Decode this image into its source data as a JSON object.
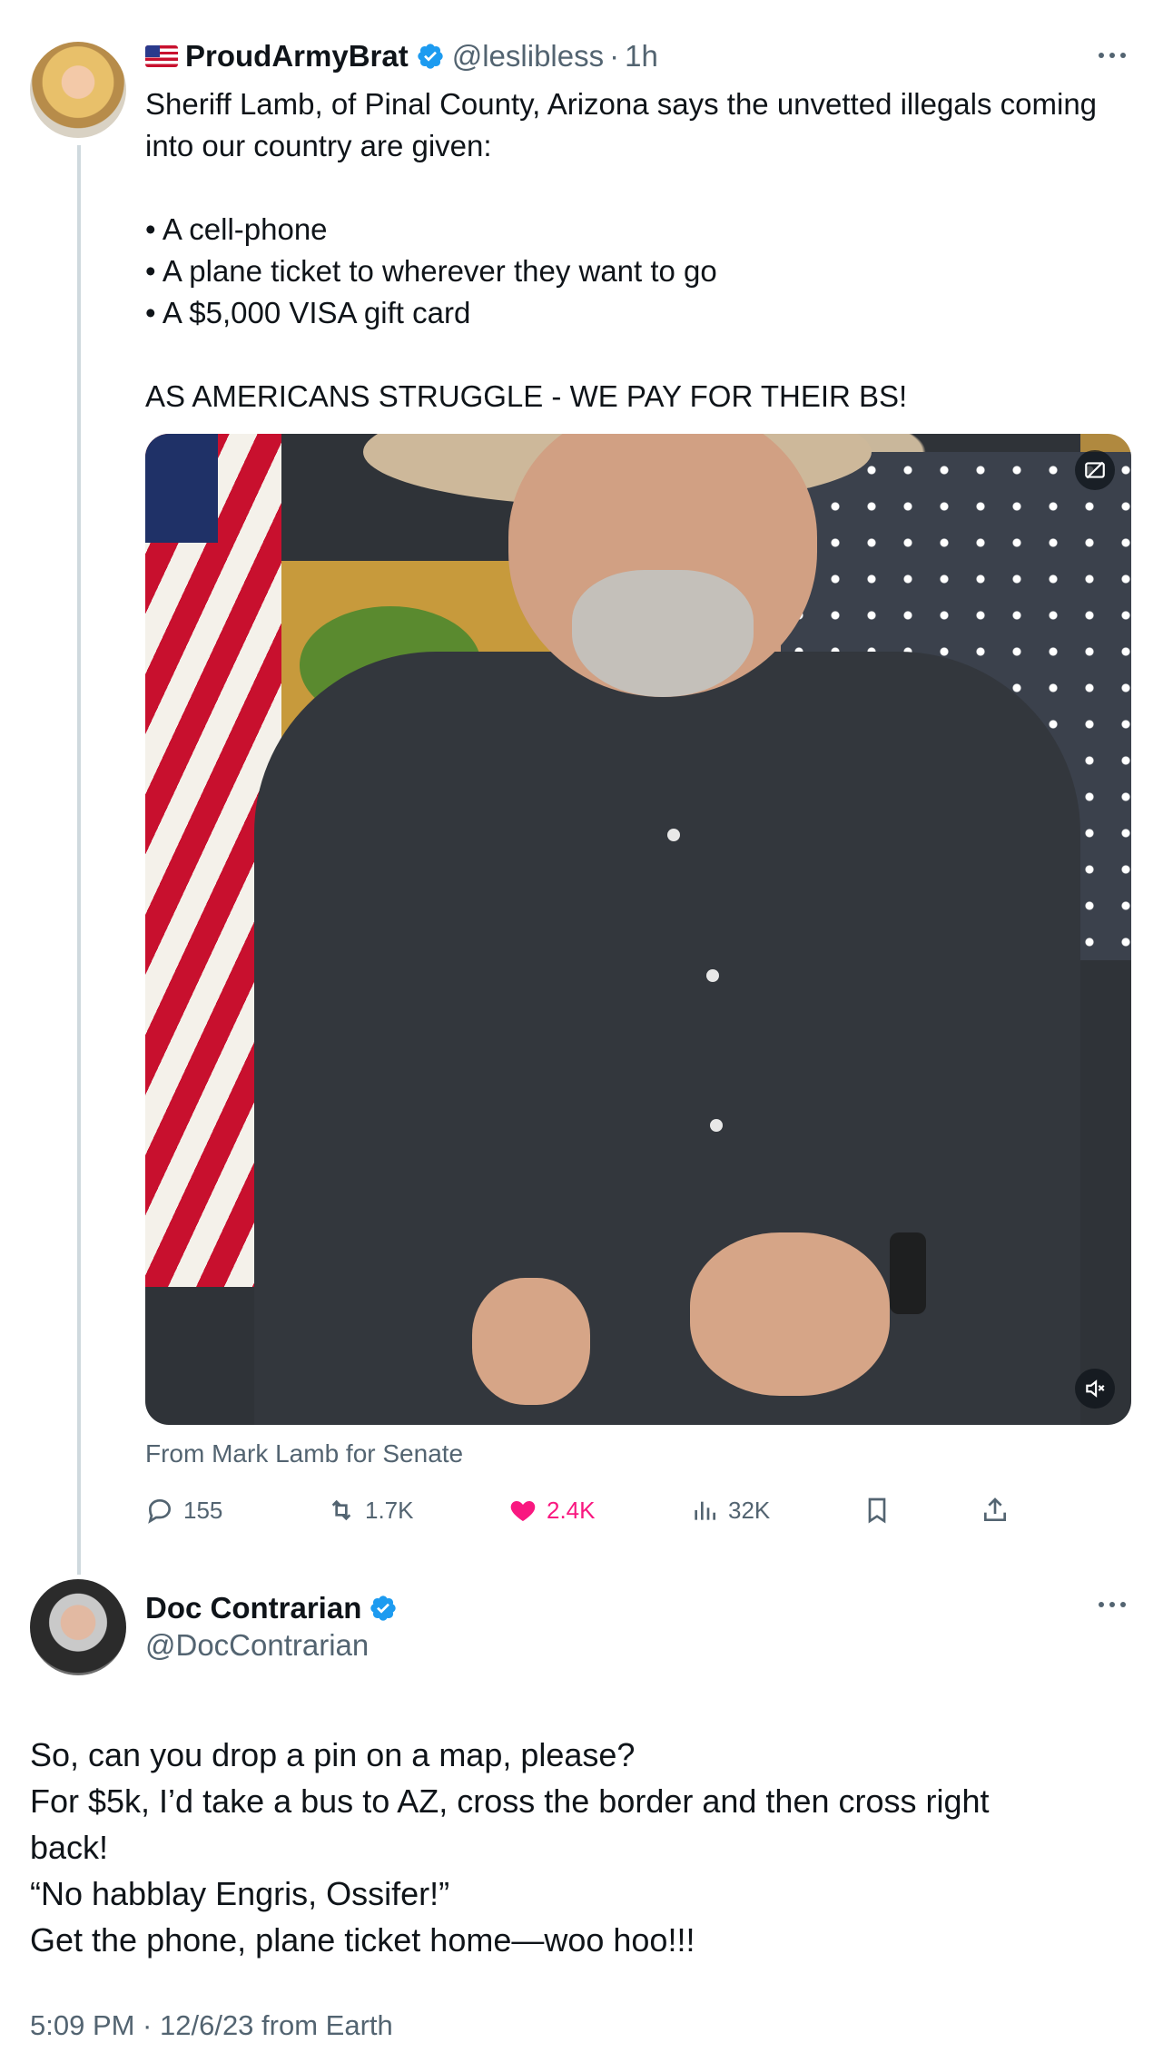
{
  "parent_tweet": {
    "display_name": "ProudArmyBrat",
    "handle": "@leslibless",
    "separator": "·",
    "time": "1h",
    "text_intro": "Sheriff Lamb, of Pinal County, Arizona says the unvetted illegals coming into our country are given:",
    "bullets": [
      "• A cell-phone",
      "• A plane ticket to wherever they want to go",
      "• A $5,000 VISA gift card"
    ],
    "text_outro": "AS AMERICANS STRUGGLE - WE PAY FOR THEIR BS!",
    "media_source": "From Mark Lamb for Senate",
    "stats": {
      "replies": "155",
      "retweets": "1.7K",
      "likes": "2.4K",
      "views": "32K"
    }
  },
  "reply_tweet": {
    "display_name": "Doc Contrarian",
    "handle": "@DocContrarian",
    "lines": [
      "So, can you drop a pin on a map, please?",
      "For $5k, I’d take a bus to AZ, cross the border and then cross right",
      "back!",
      "“No habblay Engris, Ossifer!”",
      "Get the phone, plane ticket home—woo hoo!!!"
    ],
    "timestamp": "5:09 PM · 12/6/23 from Earth"
  },
  "colors": {
    "verified_blue": "#1d9bf0",
    "like_pink": "#f91880",
    "secondary_text": "#536471",
    "primary_text": "#0f1419",
    "thread_line": "#cfd9de"
  }
}
